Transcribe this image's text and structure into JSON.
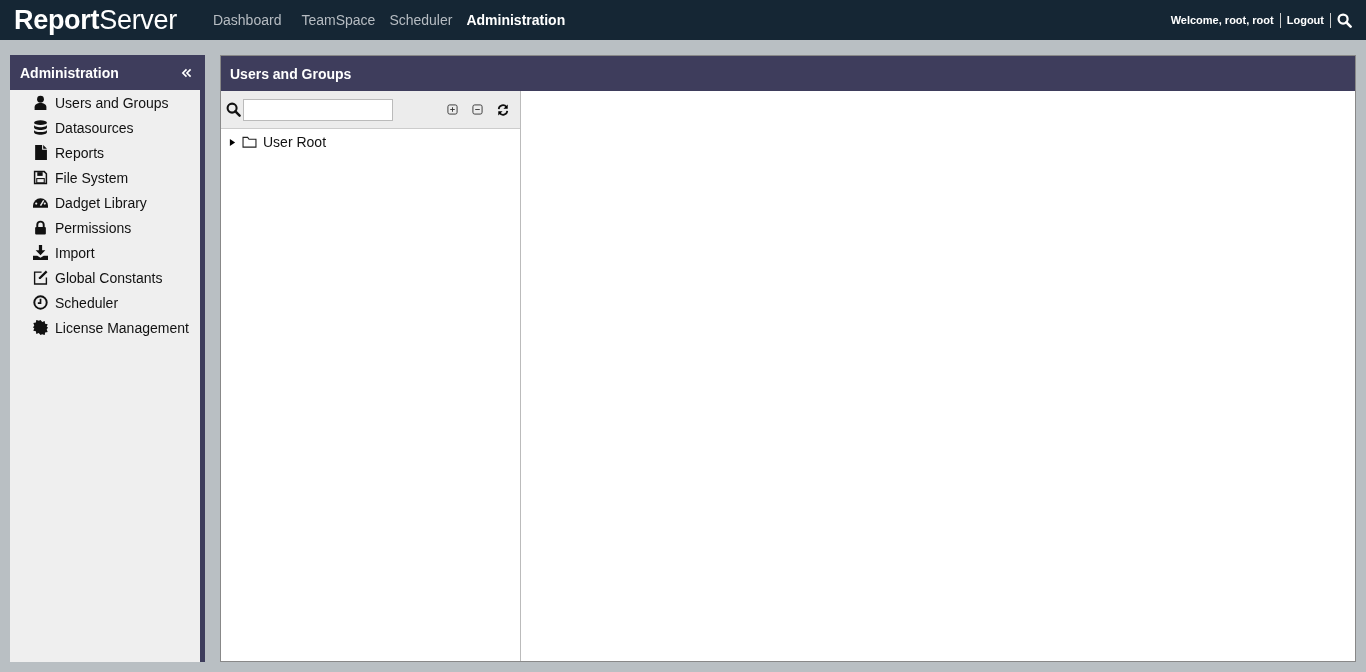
{
  "header": {
    "logo": "**Report**Server",
    "nav": [
      {
        "label": "Dashboard",
        "selected": false
      },
      {
        "label": "TeamSpace",
        "selected": false
      },
      {
        "label": "Scheduler",
        "selected": false
      },
      {
        "label": "Administration",
        "selected": true
      }
    ],
    "welcome": "Welcome, root, root",
    "logout": "Logout"
  },
  "sidebar": {
    "title": "Administration",
    "items": [
      {
        "label": "Users and Groups"
      },
      {
        "label": "Datasources"
      },
      {
        "label": "Reports"
      },
      {
        "label": "File System"
      },
      {
        "label": "Dadget Library"
      },
      {
        "label": "Permissions"
      },
      {
        "label": "Import"
      },
      {
        "label": "Global Constants"
      },
      {
        "label": "Scheduler"
      },
      {
        "label": "License Management"
      }
    ]
  },
  "panel": {
    "title": "Users and Groups",
    "tree": [
      {
        "label": "User Root",
        "expanded": false
      }
    ]
  }
}
